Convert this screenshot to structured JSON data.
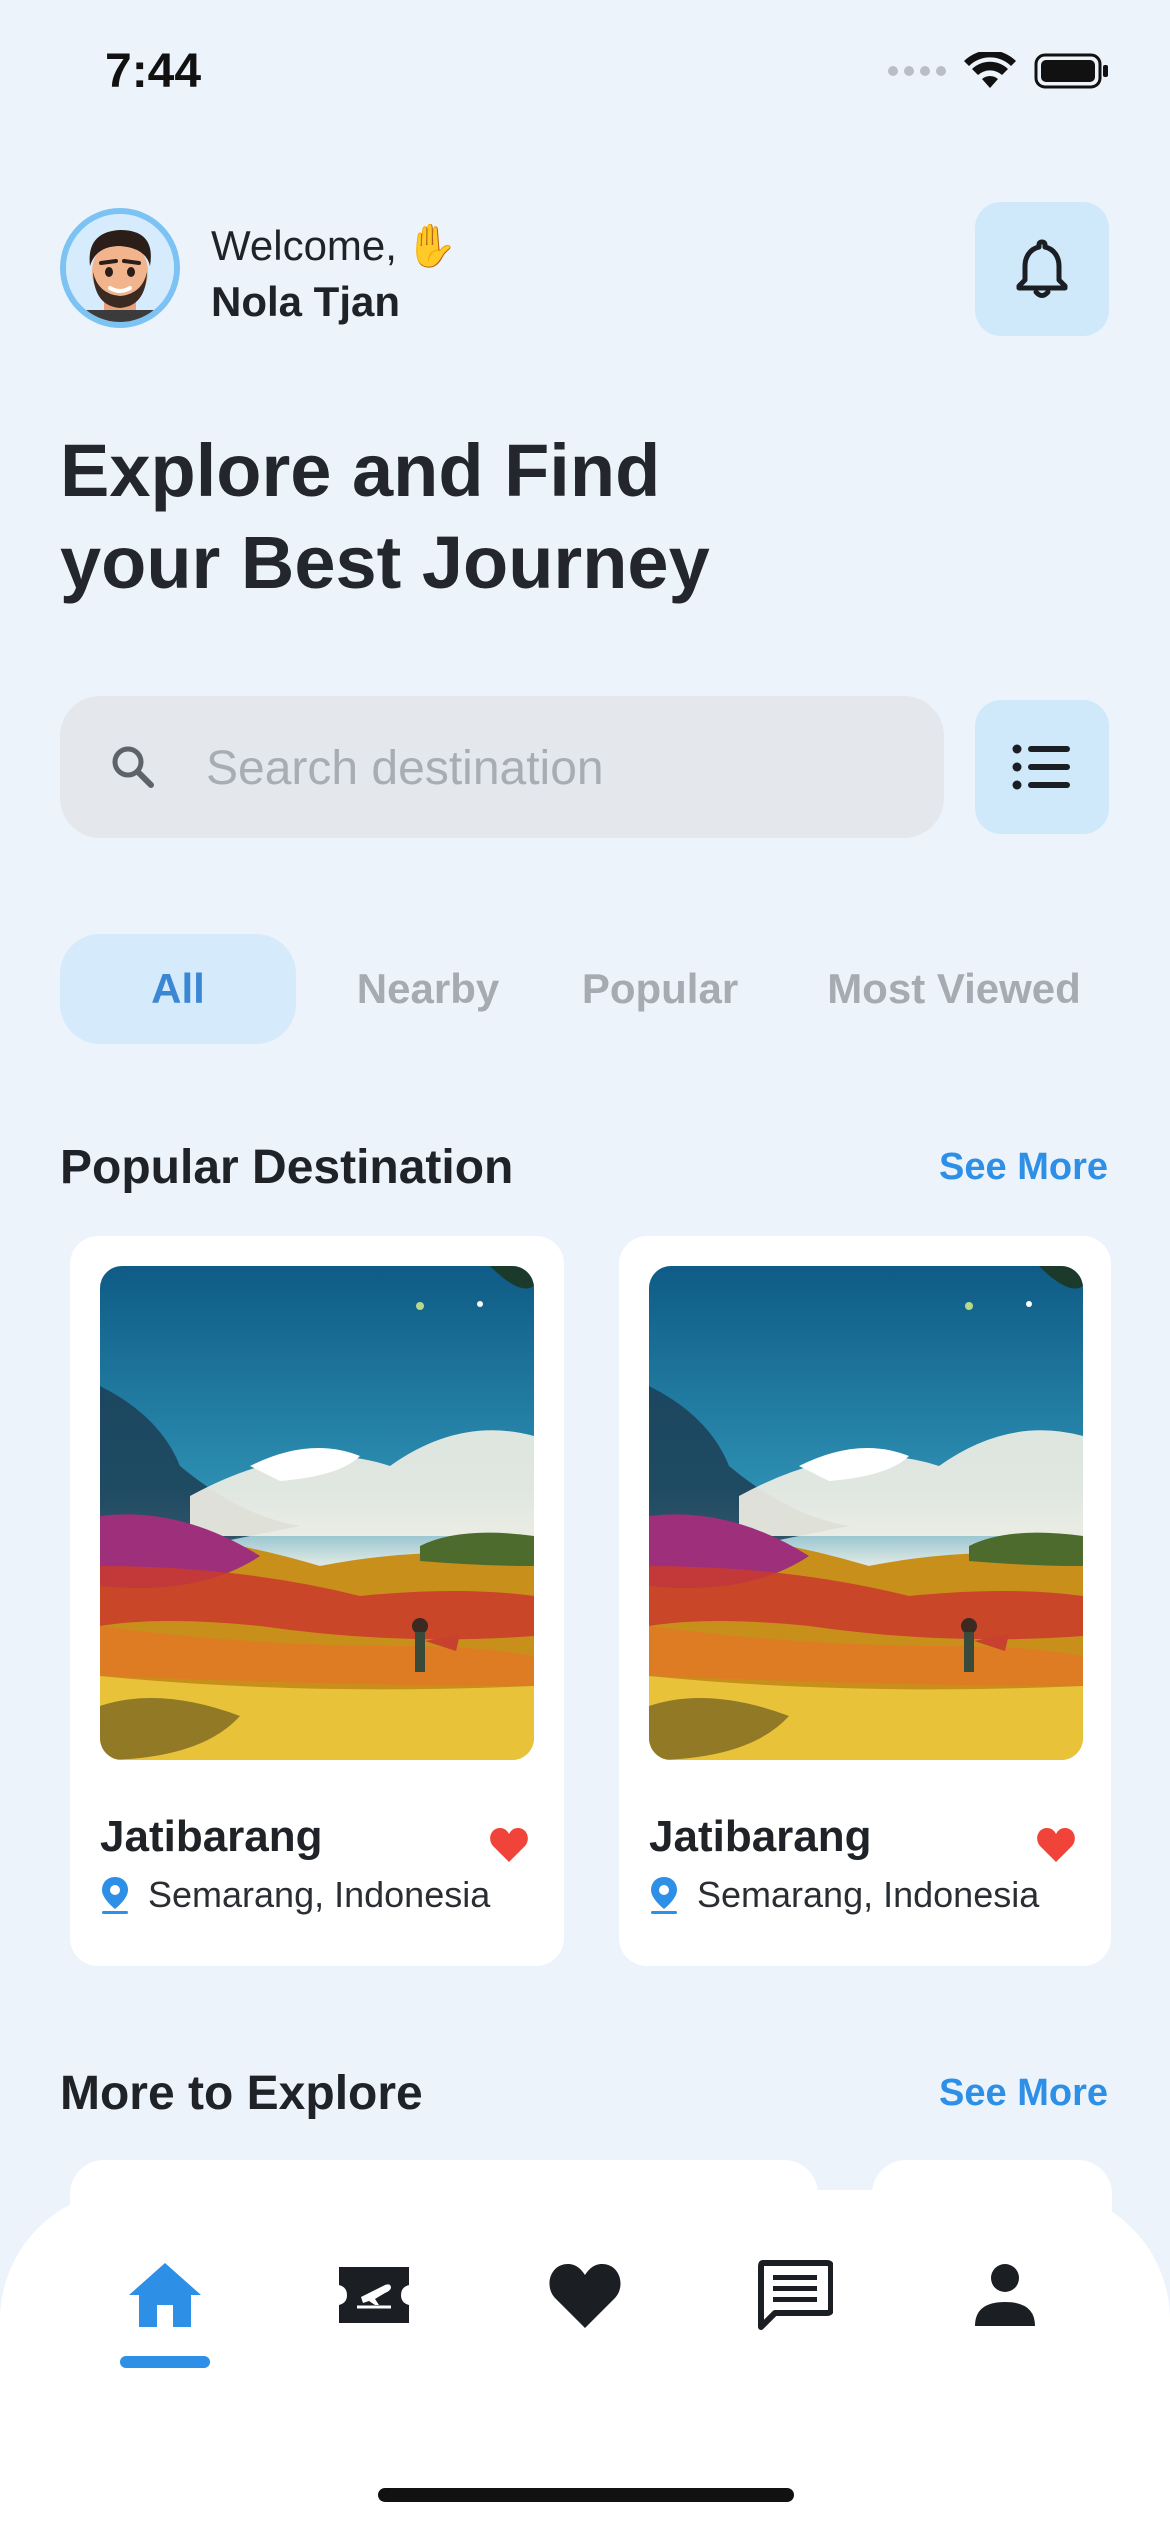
{
  "status_bar": {
    "time": "7:44"
  },
  "header": {
    "welcome": "Welcome,",
    "wave_emoji": "✋",
    "user_name": "Nola Tjan"
  },
  "hero": {
    "line1": "Explore and Find",
    "line2": "your Best Journey"
  },
  "search": {
    "placeholder": "Search destination",
    "value": ""
  },
  "tabs": [
    {
      "label": "All",
      "active": true
    },
    {
      "label": "Nearby",
      "active": false
    },
    {
      "label": "Popular",
      "active": false
    },
    {
      "label": "Most Viewed",
      "active": false
    }
  ],
  "popular": {
    "title": "Popular Destination",
    "see_more": "See More",
    "cards": [
      {
        "name": "Jatibarang",
        "location": "Semarang, Indonesia",
        "favorited": true
      },
      {
        "name": "Jatibarang",
        "location": "Semarang, Indonesia",
        "favorited": true
      }
    ]
  },
  "explore": {
    "title": "More to Explore",
    "see_more": "See More"
  },
  "nav": {
    "items": [
      "home-icon",
      "ticket-icon",
      "heart-icon",
      "chat-icon",
      "profile-icon"
    ],
    "active": "home-icon"
  },
  "colors": {
    "background": "#EDF3FB",
    "accent": "#2E8FE6",
    "chip_bg": "#CFE9FB",
    "heart": "#F0443A"
  }
}
